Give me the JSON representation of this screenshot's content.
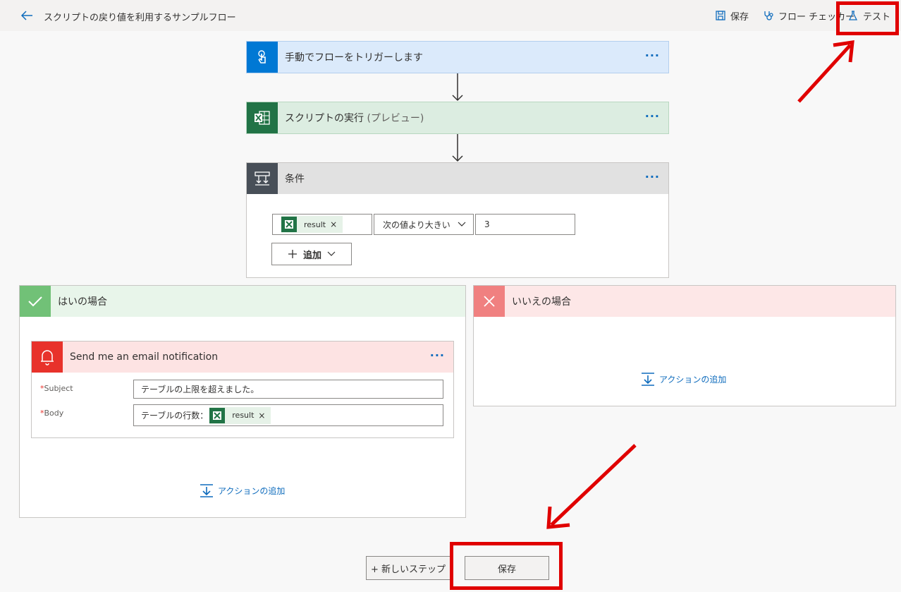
{
  "header": {
    "title": "スクリプトの戻り値を利用するサンプルフロー",
    "save_label": "保存",
    "checker_label": "フロー チェッカー",
    "test_label": "テスト"
  },
  "steps": {
    "trigger": {
      "title": "手動でフローをトリガーします",
      "color": "#0078d4"
    },
    "script": {
      "title": "スクリプトの実行",
      "subtitle": "(プレビュー)",
      "color": "#217346"
    },
    "condition": {
      "title": "条件",
      "token": "result",
      "operator": "次の値より大きい",
      "value": "3",
      "add_label": "追加"
    }
  },
  "branches": {
    "yes": {
      "title": "はいの場合",
      "action": {
        "title": "Send me an email notification",
        "subject_label": "Subject",
        "subject_value": "テーブルの上限を超えました。",
        "body_label": "Body",
        "body_prefix": "テーブルの行数：",
        "body_token": "result"
      },
      "add_action": "アクションの追加"
    },
    "no": {
      "title": "いいえの場合",
      "add_action": "アクションの追加"
    }
  },
  "footer": {
    "new_step": "+ 新しいステップ",
    "save": "保存"
  },
  "colors": {
    "accent": "#0f6cbd",
    "highlight": "#e00000",
    "yes": "#71c177",
    "no": "#f08080",
    "notify": "#e8322b"
  }
}
